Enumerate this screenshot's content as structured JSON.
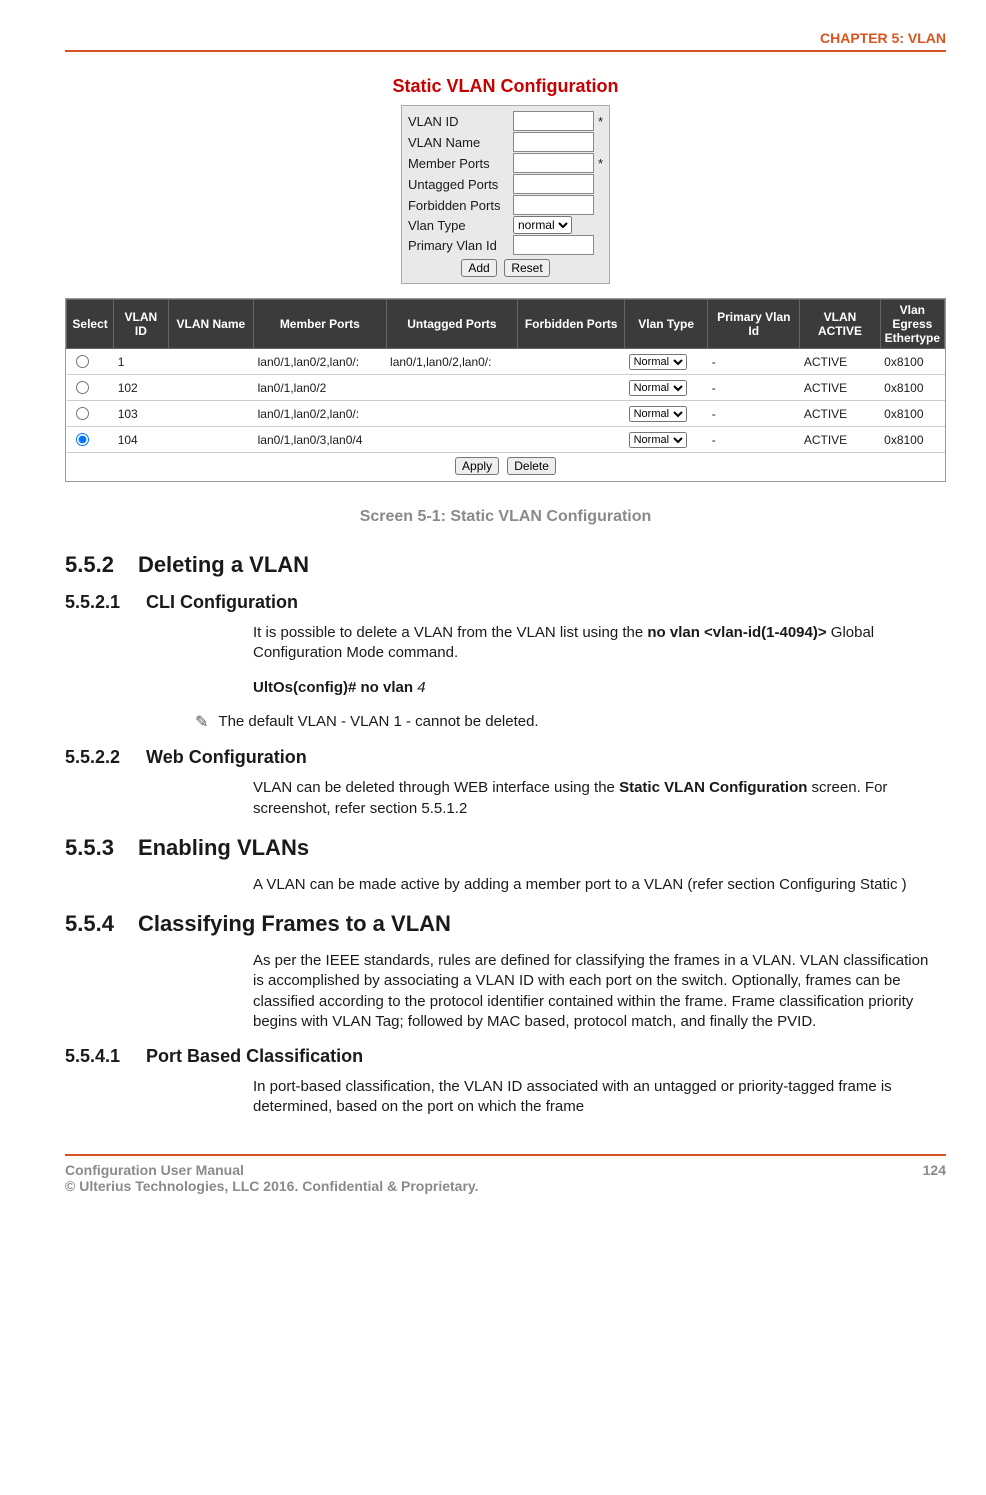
{
  "header": {
    "chapter": "CHAPTER 5: VLAN"
  },
  "figure": {
    "panel_title": "Static VLAN Configuration",
    "form": {
      "rows": [
        {
          "label": "VLAN ID",
          "type": "text",
          "required": true
        },
        {
          "label": "VLAN Name",
          "type": "text",
          "required": false
        },
        {
          "label": "Member Ports",
          "type": "text",
          "required": true
        },
        {
          "label": "Untagged Ports",
          "type": "text",
          "required": false
        },
        {
          "label": "Forbidden Ports",
          "type": "text",
          "required": false
        },
        {
          "label": "Vlan Type",
          "type": "select",
          "value": "normal",
          "required": false
        },
        {
          "label": "Primary Vlan Id",
          "type": "text",
          "required": false
        }
      ],
      "buttons": {
        "add": "Add",
        "reset": "Reset"
      }
    },
    "table": {
      "headers": [
        "Select",
        "VLAN ID",
        "VLAN Name",
        "Member Ports",
        "Untagged Ports",
        "Forbidden Ports",
        "Vlan Type",
        "Primary Vlan Id",
        "VLAN ACTIVE",
        "Vlan Egress Ethertype"
      ],
      "rows": [
        {
          "selected": false,
          "id": "1",
          "name": "",
          "member": "lan0/1,lan0/2,lan0/:",
          "untagged": "lan0/1,lan0/2,lan0/:",
          "forbidden": "",
          "type": "Normal",
          "primary": "-",
          "active": "ACTIVE",
          "egress": "0x8100"
        },
        {
          "selected": false,
          "id": "102",
          "name": "",
          "member": "lan0/1,lan0/2",
          "untagged": "",
          "forbidden": "",
          "type": "Normal",
          "primary": "-",
          "active": "ACTIVE",
          "egress": "0x8100"
        },
        {
          "selected": false,
          "id": "103",
          "name": "",
          "member": "lan0/1,lan0/2,lan0/:",
          "untagged": "",
          "forbidden": "",
          "type": "Normal",
          "primary": "-",
          "active": "ACTIVE",
          "egress": "0x8100"
        },
        {
          "selected": true,
          "id": "104",
          "name": "",
          "member": "lan0/1,lan0/3,lan0/4",
          "untagged": "",
          "forbidden": "",
          "type": "Normal",
          "primary": "-",
          "active": "ACTIVE",
          "egress": "0x8100"
        }
      ],
      "buttons": {
        "apply": "Apply",
        "delete": "Delete"
      }
    },
    "caption": "Screen 5-1: Static VLAN Configuration"
  },
  "sections": {
    "s552": {
      "num": "5.5.2",
      "title": "Deleting a VLAN",
      "s5521": {
        "num": "5.5.2.1",
        "title": "CLI Configuration",
        "p1_pre": "It is possible to delete a VLAN from the VLAN list using the ",
        "p1_bold": "no vlan <vlan-id(1-4094)>",
        "p1_post": " Global Configuration Mode command.",
        "cmd_prefix": "UltOs(config)# no vlan ",
        "cmd_arg": "4",
        "note": "The default VLAN - VLAN 1 - cannot be deleted."
      },
      "s5522": {
        "num": "5.5.2.2",
        "title": "Web Configuration",
        "p_pre": "VLAN can be deleted through WEB interface using the ",
        "p_bold": "Static VLAN Configuration",
        "p_post": " screen. For screenshot, refer section 5.5.1.2"
      }
    },
    "s553": {
      "num": "5.5.3",
      "title": "Enabling VLANs",
      "p": "A VLAN can be made active by adding a member port to a VLAN (refer section Configuring Static )"
    },
    "s554": {
      "num": "5.5.4",
      "title": "Classifying Frames to a VLAN",
      "p": "As per the IEEE standards, rules are defined for classifying the frames in a VLAN. VLAN classification is accomplished by associating a VLAN ID with each port on the switch. Optionally, frames can be classified according to the protocol identifier contained within the frame. Frame classification priority begins with VLAN Tag; followed by MAC based, protocol match, and finally the PVID.",
      "s5541": {
        "num": "5.5.4.1",
        "title": "Port Based Classification",
        "p": "In port-based classification, the VLAN ID associated with an untagged or priority-tagged frame is determined, based on the port on which the frame"
      }
    }
  },
  "footer": {
    "left1": "Configuration User Manual",
    "left2": "© Ulterius Technologies, LLC 2016. Confidential & Proprietary.",
    "page": "124"
  }
}
